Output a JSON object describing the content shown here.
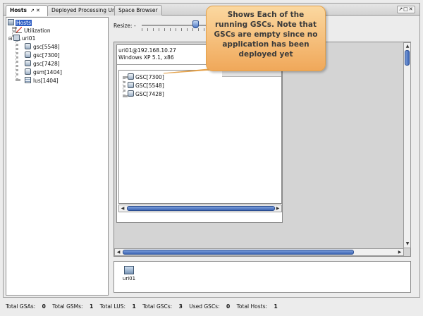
{
  "tabs": [
    {
      "label": "Hosts",
      "active": true
    },
    {
      "label": "Deployed Processing Units",
      "active": false
    },
    {
      "label": "Space Browser",
      "active": false
    }
  ],
  "tab_controls": "↗ ✕",
  "window_controls": "↗□✕",
  "tree": {
    "root": "Hosts",
    "utilization": "Utilization",
    "host": "uri01",
    "children": [
      "gsc[5548]",
      "gsc[7300]",
      "gsc[7428]",
      "gsm[1404]",
      "lus[1404]"
    ]
  },
  "resize": {
    "label": "Resize:",
    "minus": "-",
    "level_percent": 48
  },
  "host_panel": {
    "address": "uri01@192.168.10.27",
    "os": "Windows XP 5.1, x86",
    "gscs": [
      "GSC[7300]",
      "GSC[5548]",
      "GSC[7428]"
    ]
  },
  "bottom": {
    "machine_label": "uri01"
  },
  "callout": "Shows Each of the running GSCs. Note that GSCs are empty since no application has been deployed yet",
  "status": {
    "gsa_label": "Total GSAs:",
    "gsa_value": "0",
    "gsm_label": "Total GSMs:",
    "gsm_value": "1",
    "lus_label": "Total LUS:",
    "lus_value": "1",
    "gsc_label": "Total GSCs:",
    "gsc_value": "3",
    "used_label": "Used GSCs:",
    "used_value": "0",
    "hosts_label": "Total Hosts:",
    "hosts_value": "1"
  },
  "icons": [
    "hosts-icon",
    "utilization-icon",
    "computer-icon",
    "gsc-icon",
    "gsm-icon",
    "lus-icon",
    "machine-icon"
  ]
}
